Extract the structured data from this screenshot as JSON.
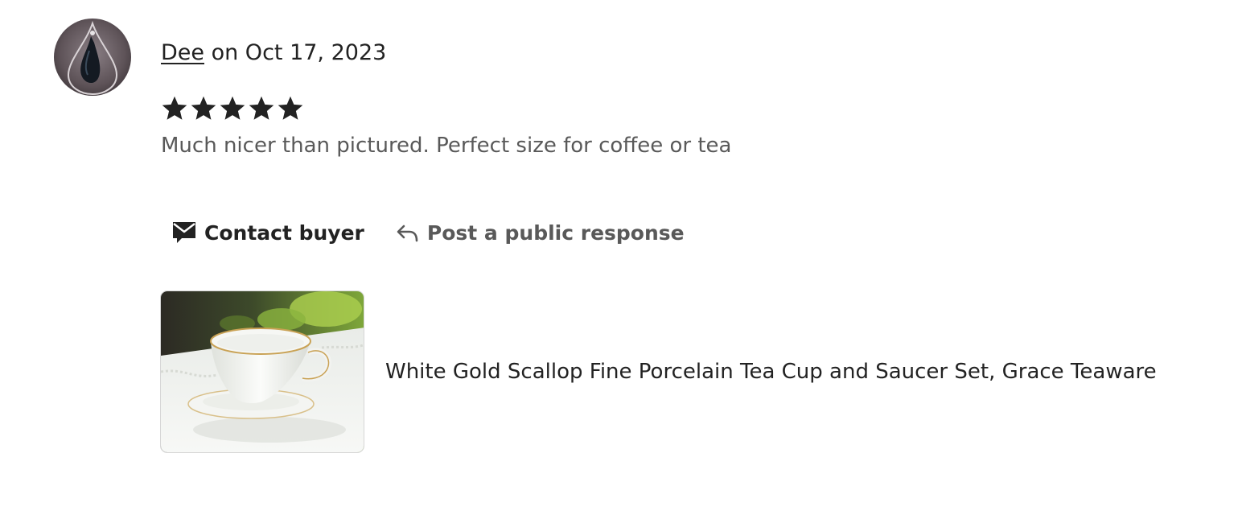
{
  "review": {
    "reviewer_name": "Dee",
    "date_text": " on Oct 17, 2023",
    "rating": 5,
    "rating_max": 5,
    "text": "Much nicer than pictured. Perfect size for coffee or tea"
  },
  "actions": {
    "contact_label": "Contact buyer",
    "contact_icon": "envelope-icon",
    "respond_label": "Post a public response",
    "respond_icon": "reply-arrow-icon"
  },
  "listing": {
    "title": "White Gold Scallop Fine Porcelain Tea Cup and Saucer Set, Grace Teaware"
  },
  "colors": {
    "text": "#222222",
    "muted_text": "#595959"
  }
}
